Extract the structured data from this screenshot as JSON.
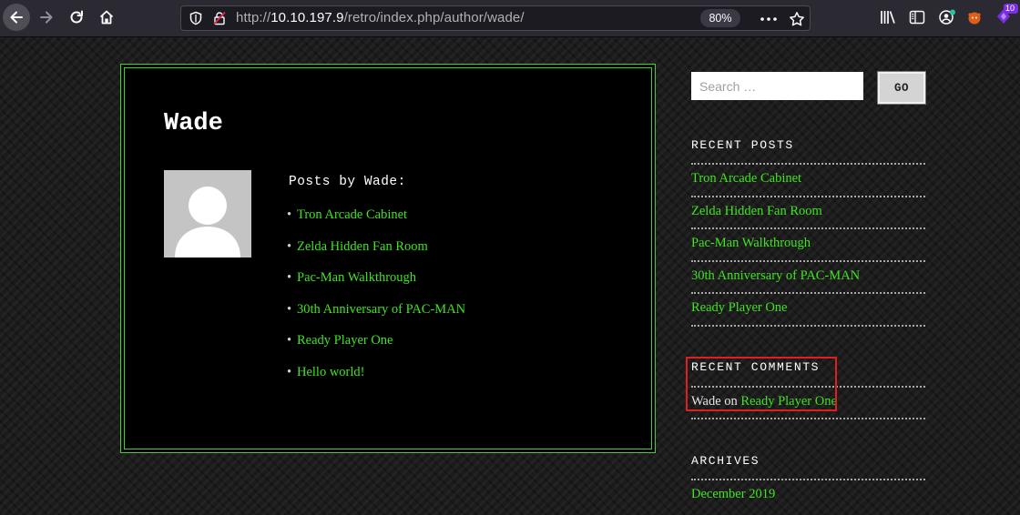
{
  "browser": {
    "url_prefix": "http://",
    "url_host": "10.10.197.9",
    "url_path": "/retro/index.php/author/wade/",
    "zoom": "80%",
    "extension_badge": "10"
  },
  "author": {
    "name": "Wade",
    "posts_heading": "Posts by Wade:",
    "posts": [
      "Tron Arcade Cabinet",
      "Zelda Hidden Fan Room",
      "Pac-Man Walkthrough",
      "30th Anniversary of PAC-MAN",
      "Ready Player One",
      "Hello world!"
    ]
  },
  "sidebar": {
    "search_placeholder": "Search …",
    "go_label": "GO",
    "recent_posts_title": "RECENT POSTS",
    "recent_posts": [
      "Tron Arcade Cabinet",
      "Zelda Hidden Fan Room",
      "Pac-Man Walkthrough",
      "30th Anniversary of PAC-MAN",
      "Ready Player One"
    ],
    "recent_comments_title": "RECENT COMMENTS",
    "comment_author": "Wade",
    "comment_on": " on ",
    "comment_post": "Ready Player One",
    "archives_title": "ARCHIVES",
    "archives": [
      "December 2019"
    ]
  },
  "colors": {
    "link": "#3fe51f",
    "box_border": "#3fd32b",
    "highlight": "#e02020"
  }
}
